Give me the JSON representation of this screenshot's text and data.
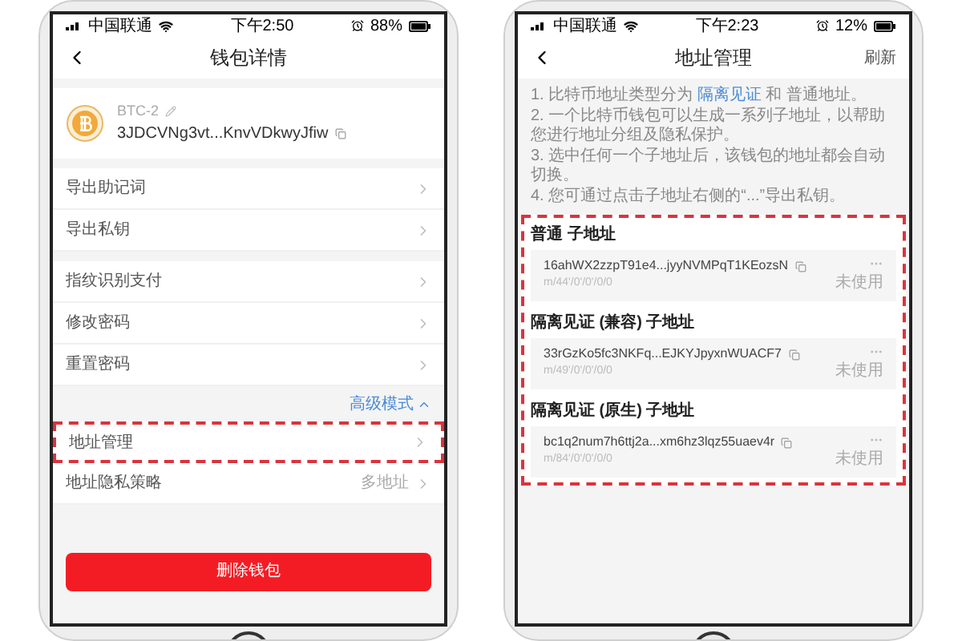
{
  "left_screen": {
    "status_bar": {
      "carrier": "中国联通",
      "time": "下午2:50",
      "battery": "88%"
    },
    "title": "钱包详情",
    "wallet": {
      "name": "BTC-2",
      "address": "3JDCVNg3vt...KnvVDkwyJfiw"
    },
    "groups": [
      {
        "rows": [
          {
            "label": "导出助记词",
            "highlighted": false
          },
          {
            "label": "导出私钥",
            "highlighted": false
          }
        ]
      },
      {
        "rows": [
          {
            "label": "指纹识别支付",
            "highlighted": false
          },
          {
            "label": "修改密码",
            "highlighted": false
          },
          {
            "label": "重置密码",
            "highlighted": false
          }
        ]
      }
    ],
    "advanced_toggle": {
      "label": "高级模式",
      "expanded": true
    },
    "advanced_rows": [
      {
        "label": "地址管理",
        "highlighted": true
      },
      {
        "label": "地址隐私策略",
        "value": "多地址",
        "highlighted": false
      }
    ],
    "delete_button": "删除钱包"
  },
  "right_screen": {
    "status_bar": {
      "carrier": "中国联通",
      "time": "下午2:23",
      "battery": "12%"
    },
    "title": "地址管理",
    "refresh": "刷新",
    "info": [
      {
        "text": "1. 比特币地址类型分为 ",
        "link": "隔离见证",
        "after": " 和 普通地址。"
      },
      {
        "text": "2. 一个比特币钱包可以生成一系列子地址，以帮助您进行地址分组及隐私保护。"
      },
      {
        "text": "3. 选中任何一个子地址后，该钱包的地址都会自动切换。"
      },
      {
        "text": "4. 您可通过点击子地址右侧的“...”导出私钥。"
      }
    ],
    "sections_highlighted": true,
    "sections": [
      {
        "title": "普通 子地址",
        "address": "16ahWX2zzpT91e4...jyyNVMPqT1KEozsN",
        "path": "m/44'/0'/0'/0/0",
        "status": "未使用"
      },
      {
        "title": "隔离见证 (兼容) 子地址",
        "address": "33rGzKo5fc3NKFq...EJKYJpyxnWUACF7",
        "path": "m/49'/0'/0'/0/0",
        "status": "未使用"
      },
      {
        "title": "隔离见证 (原生) 子地址",
        "address": "bc1q2num7h6ttj2a...xm6hz3lqz55uaev4r",
        "path": "m/84'/0'/0'/0/0",
        "status": "未使用"
      }
    ]
  }
}
